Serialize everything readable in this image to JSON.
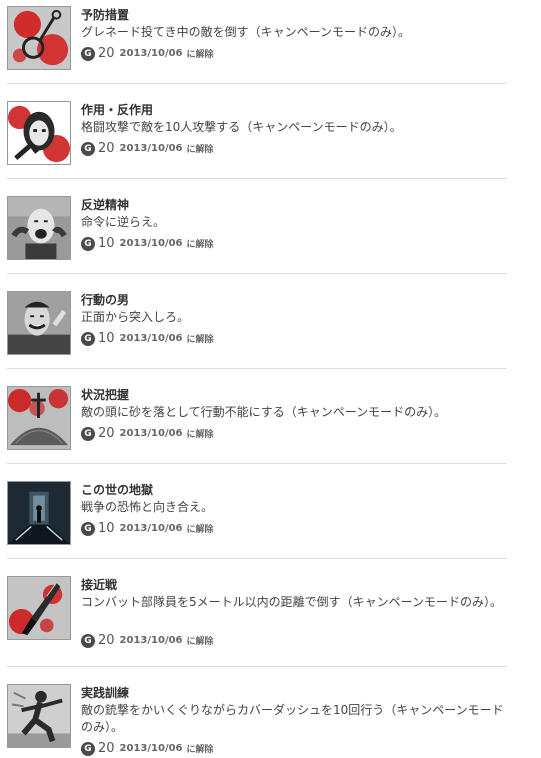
{
  "achievements": [
    {
      "title": "予防措置",
      "description": "グレネード投てき中の敵を倒す（キャンペーンモードのみ）。",
      "gamerscore": "20",
      "date": "2013/10/06",
      "status": "に解除",
      "icon": "grenade-pin-icon",
      "colors": [
        "#c8c8c8",
        "#d40f0f"
      ]
    },
    {
      "title": "作用・反作用",
      "description": "格闘攻撃で敵を10人攻撃する（キャンペーンモードのみ）。",
      "gamerscore": "20",
      "date": "2013/10/06",
      "status": "に解除",
      "icon": "punch-face-icon",
      "colors": [
        "#2a2a2a",
        "#c81010"
      ]
    },
    {
      "title": "反逆精神",
      "description": "命令に逆らえ。",
      "gamerscore": "10",
      "date": "2013/10/06",
      "status": "に解除",
      "icon": "shouting-man-icon",
      "colors": [
        "#3a3a3a",
        "#9a9a9a"
      ]
    },
    {
      "title": "行動の男",
      "description": "正面から突入しろ。",
      "gamerscore": "10",
      "date": "2013/10/06",
      "status": "に解除",
      "icon": "grinning-man-icon",
      "colors": [
        "#444444",
        "#a0a0a0"
      ]
    },
    {
      "title": "状況把握",
      "description": "敵の頭に砂を落として行動不能にする（キャンペーンモードのみ）。",
      "gamerscore": "20",
      "date": "2013/10/06",
      "status": "に解除",
      "icon": "sand-pile-icon",
      "colors": [
        "#bdbdbd",
        "#cc1010"
      ]
    },
    {
      "title": "この世の地獄",
      "description": "戦争の恐怖と向き合え。",
      "gamerscore": "10",
      "date": "2013/10/06",
      "status": "に解除",
      "icon": "dark-corridor-icon",
      "colors": [
        "#1d2a33",
        "#8aa6b8"
      ]
    },
    {
      "title": "接近戦",
      "description": "コンバット部隊員を5メートル以内の距離で倒す（キャンペーンモードのみ）。",
      "gamerscore": "20",
      "date": "2013/10/06",
      "status": "に解除",
      "icon": "combat-knife-icon",
      "colors": [
        "#c4c4c4",
        "#cc1010"
      ]
    },
    {
      "title": "実践訓練",
      "description": "敵の銃撃をかいくぐりながらカバーダッシュを10回行う（キャンペーンモードのみ）。",
      "gamerscore": "20",
      "date": "2013/10/06",
      "status": "に解除",
      "icon": "running-soldier-icon",
      "colors": [
        "#cfcfcf",
        "#2a2a2a"
      ]
    }
  ],
  "gamerscore_icon_letter": "G"
}
